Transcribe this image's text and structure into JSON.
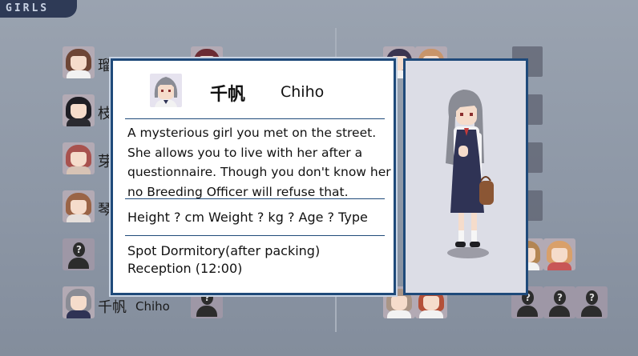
{
  "tab": {
    "label": "GIRLS"
  },
  "list": {
    "rows": [
      {
        "jp": "瑠"
      },
      {
        "jp": "枝"
      },
      {
        "jp": "芽"
      },
      {
        "jp": "琴"
      }
    ],
    "selected": {
      "jp": "千帆",
      "en": "Chiho"
    },
    "unknown_mark": "?"
  },
  "profile": {
    "name_jp": "千帆",
    "name_en": "Chiho",
    "description": [
      "A mysterious girl you met on the street.",
      "She allows you to live with her after a",
      "questionnaire. Though you don't know her",
      "no Breeding Officer will refuse that."
    ],
    "stats": "Height ? cm Weight ? kg ? Age ? Type",
    "spot_line1": "Spot Dormitory(after packing)",
    "spot_line2": "Reception (12:00)"
  },
  "colors": {
    "panel_border": "#1f4a7a",
    "hair_gray": "#8a8c95",
    "uniform": "#2f3355"
  }
}
